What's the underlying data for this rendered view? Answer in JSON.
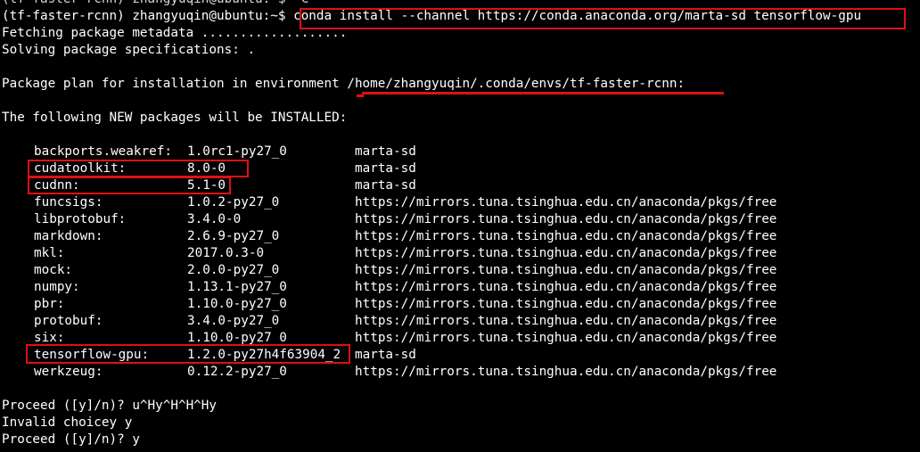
{
  "terminal": {
    "top_cut_line": "(tf-faster-rcnn) zhangyuqin@ubuntu:~$ ^C",
    "prompt": "(tf-faster-rcnn) zhangyuqin@ubuntu:~$ ",
    "command": "conda install --channel https://conda.anaconda.org/marta-sd tensorflow-gpu",
    "fetching": "Fetching package metadata ...................",
    "solving": "Solving package specifications: .",
    "plan_prefix": "Package plan for installation in environment ",
    "plan_path": "/home/zhangyuqin/.conda/envs/tf-faster-rcnn:",
    "new_packages_header": "The following NEW packages will be INSTALLED:",
    "packages": [
      {
        "name": "backports.weakref:",
        "version": "1.0rc1-py27_0",
        "source": "marta-sd"
      },
      {
        "name": "cudatoolkit:",
        "version": "8.0-0",
        "source": "marta-sd"
      },
      {
        "name": "cudnn:",
        "version": "5.1-0",
        "source": "marta-sd"
      },
      {
        "name": "funcsigs:",
        "version": "1.0.2-py27_0",
        "source": "https://mirrors.tuna.tsinghua.edu.cn/anaconda/pkgs/free"
      },
      {
        "name": "libprotobuf:",
        "version": "3.4.0-0",
        "source": "https://mirrors.tuna.tsinghua.edu.cn/anaconda/pkgs/free"
      },
      {
        "name": "markdown:",
        "version": "2.6.9-py27_0",
        "source": "https://mirrors.tuna.tsinghua.edu.cn/anaconda/pkgs/free"
      },
      {
        "name": "mkl:",
        "version": "2017.0.3-0",
        "source": "https://mirrors.tuna.tsinghua.edu.cn/anaconda/pkgs/free"
      },
      {
        "name": "mock:",
        "version": "2.0.0-py27_0",
        "source": "https://mirrors.tuna.tsinghua.edu.cn/anaconda/pkgs/free"
      },
      {
        "name": "numpy:",
        "version": "1.13.1-py27_0",
        "source": "https://mirrors.tuna.tsinghua.edu.cn/anaconda/pkgs/free"
      },
      {
        "name": "pbr:",
        "version": "1.10.0-py27_0",
        "source": "https://mirrors.tuna.tsinghua.edu.cn/anaconda/pkgs/free"
      },
      {
        "name": "protobuf:",
        "version": "3.4.0-py27_0",
        "source": "https://mirrors.tuna.tsinghua.edu.cn/anaconda/pkgs/free"
      },
      {
        "name": "six:",
        "version": "1.10.0-py27_0",
        "source": "https://mirrors.tuna.tsinghua.edu.cn/anaconda/pkgs/free"
      },
      {
        "name": "tensorflow-gpu:",
        "version": "1.2.0-py27h4f63904_2",
        "source": "marta-sd"
      },
      {
        "name": "werkzeug:",
        "version": "0.12.2-py27_0",
        "source": "https://mirrors.tuna.tsinghua.edu.cn/anaconda/pkgs/free"
      }
    ],
    "proceed_1": "Proceed ([y]/n)? u^Hy^H^H^Hy",
    "invalid": "Invalid choicey y",
    "proceed_2": "Proceed ([y]/n)? y"
  },
  "highlight_color": "#e01010"
}
